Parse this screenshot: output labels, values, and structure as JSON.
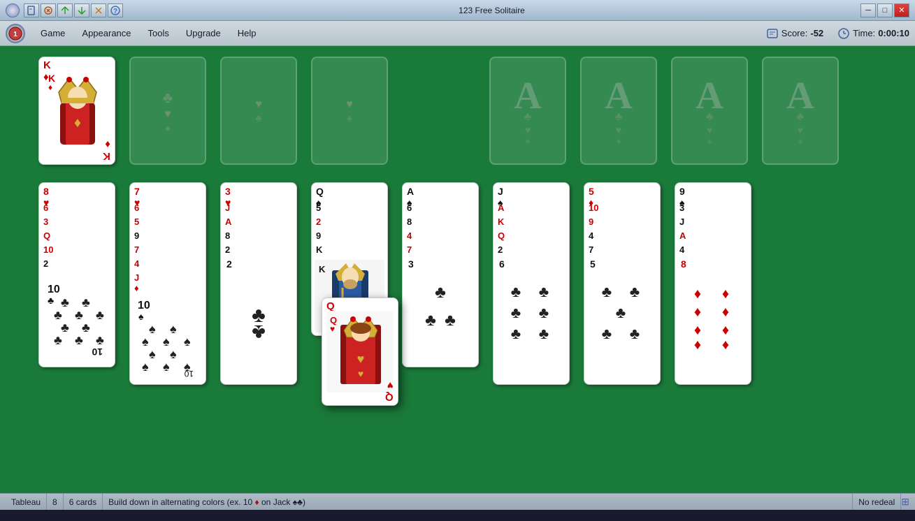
{
  "window": {
    "title": "123 Free Solitaire",
    "controls": [
      "minimize",
      "maximize",
      "close"
    ]
  },
  "menubar": {
    "items": [
      "Game",
      "Appearance",
      "Tools",
      "Upgrade",
      "Help"
    ],
    "score_label": "Score:",
    "score_value": "-52",
    "time_label": "Time:",
    "time_value": "0:00:10"
  },
  "statusbar": {
    "game_type": "Tableau",
    "col_count": "8",
    "card_count": "6 cards",
    "rule": "Build down in alternating colors (ex. 10 ♦ on Jack ♠♣)",
    "redeal": "No redeal"
  },
  "game": {
    "background_color": "#1a7a3a"
  }
}
